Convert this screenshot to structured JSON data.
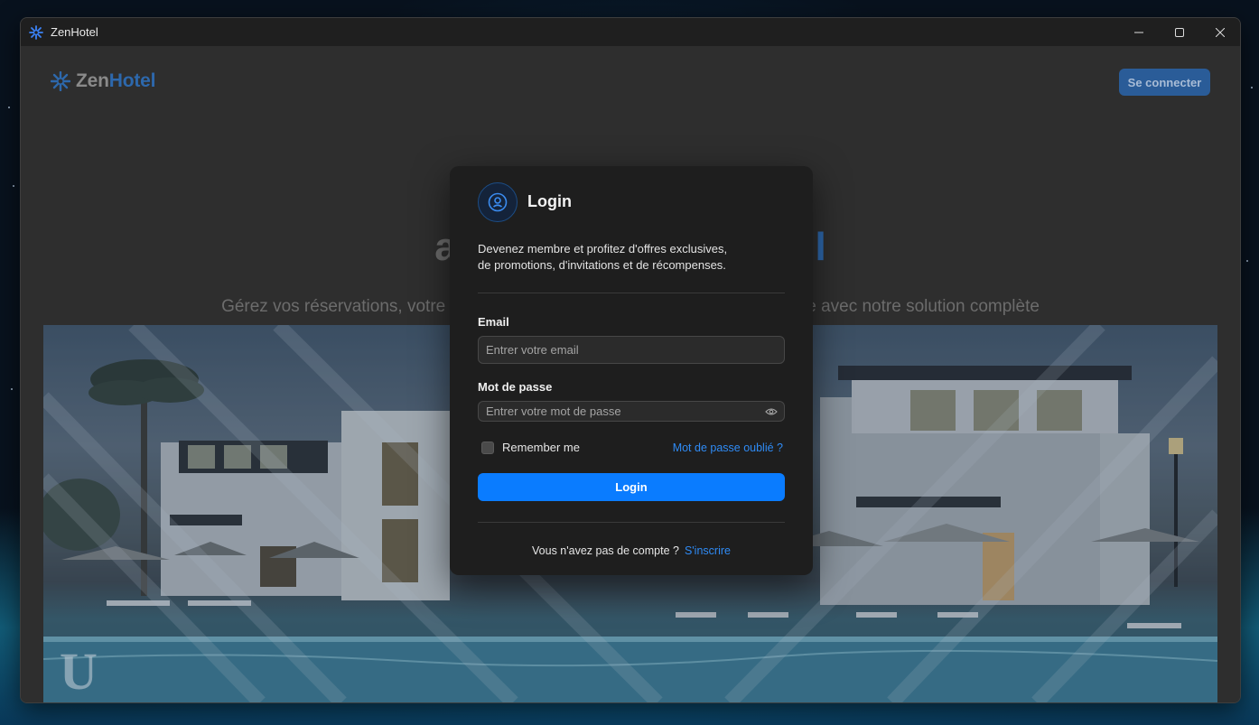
{
  "window": {
    "title": "ZenHotel",
    "controls": [
      "minimize-icon",
      "maximize-icon",
      "close-icon"
    ]
  },
  "header": {
    "logo_part1": "Zen",
    "logo_part2": "Hotel",
    "connect_label": "Se connecter"
  },
  "hero": {
    "title_left": "av",
    "title_right": "il",
    "subtitle_left": "Gérez vos réservations, votre",
    "subtitle_right": "e avec notre solution complète",
    "image_watermark": "U"
  },
  "login_modal": {
    "title": "Login",
    "description_line1": "Devenez membre et profitez d'offres exclusives,",
    "description_line2": "de promotions, d'invitations et de récompenses.",
    "email_label": "Email",
    "email_placeholder": "Entrer votre email",
    "password_label": "Mot de passe",
    "password_placeholder": "Entrer votre mot de passe",
    "remember_label": "Remember me",
    "remember_checked": false,
    "forgot_label": "Mot de passe oublié ?",
    "login_button": "Login",
    "no_account_text": "Vous n'avez pas de compte ?",
    "signup_link": "S'inscrire"
  },
  "colors": {
    "accent": "#0a7cff",
    "link": "#2f8bf5",
    "brand_blue": "#2d68ac",
    "modal_bg": "#1e1e1e",
    "page_bg": "#2e2e2e"
  }
}
